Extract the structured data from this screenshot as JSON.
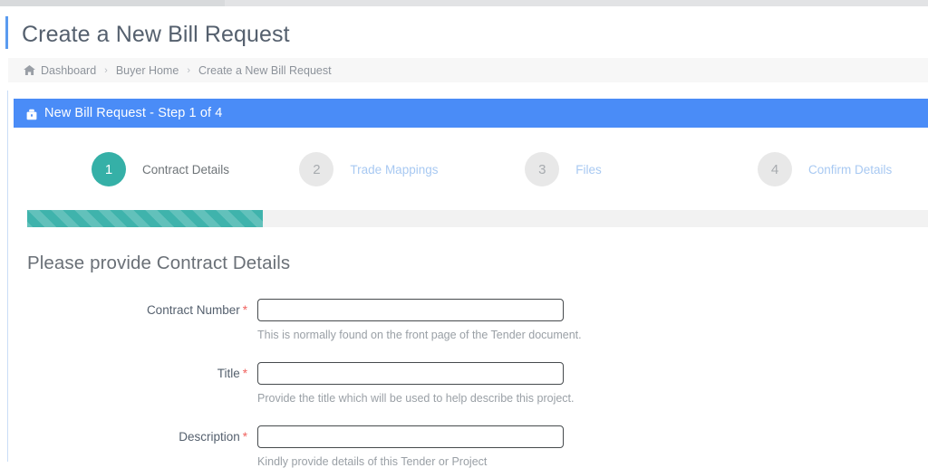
{
  "page": {
    "title": "Create a New Bill Request"
  },
  "breadcrumb": {
    "home_icon": "home-icon",
    "items": [
      {
        "label": "Dashboard"
      },
      {
        "label": "Buyer Home"
      },
      {
        "label": "Create a New Bill Request"
      }
    ],
    "separator": "›"
  },
  "panel": {
    "icon": "briefcase-icon",
    "title": "New Bill Request - Step 1 of 4",
    "header_color": "#4a8cf7"
  },
  "wizard": {
    "active_step": 1,
    "steps": [
      {
        "number": "1",
        "label": "Contract Details"
      },
      {
        "number": "2",
        "label": "Trade Mappings"
      },
      {
        "number": "3",
        "label": "Files"
      },
      {
        "number": "4",
        "label": "Confirm Details"
      }
    ],
    "active_circle_color": "#35b0a7",
    "inactive_circle_color": "#e8e8e8"
  },
  "progress": {
    "percent": 26,
    "fill_color": "#3fb3ac",
    "track_color": "#f2f2f2",
    "style": "striped"
  },
  "form": {
    "heading": "Please provide Contract Details",
    "required_marker": "*",
    "fields": [
      {
        "label": "Contract Number",
        "value": "",
        "placeholder": "",
        "help": "This is normally found on the front page of the Tender document."
      },
      {
        "label": "Title",
        "value": "",
        "placeholder": "",
        "help": "Provide the title which will be used to help describe this project."
      },
      {
        "label": "Description",
        "value": "",
        "placeholder": "",
        "help": "Kindly provide details of this Tender or Project"
      }
    ]
  }
}
